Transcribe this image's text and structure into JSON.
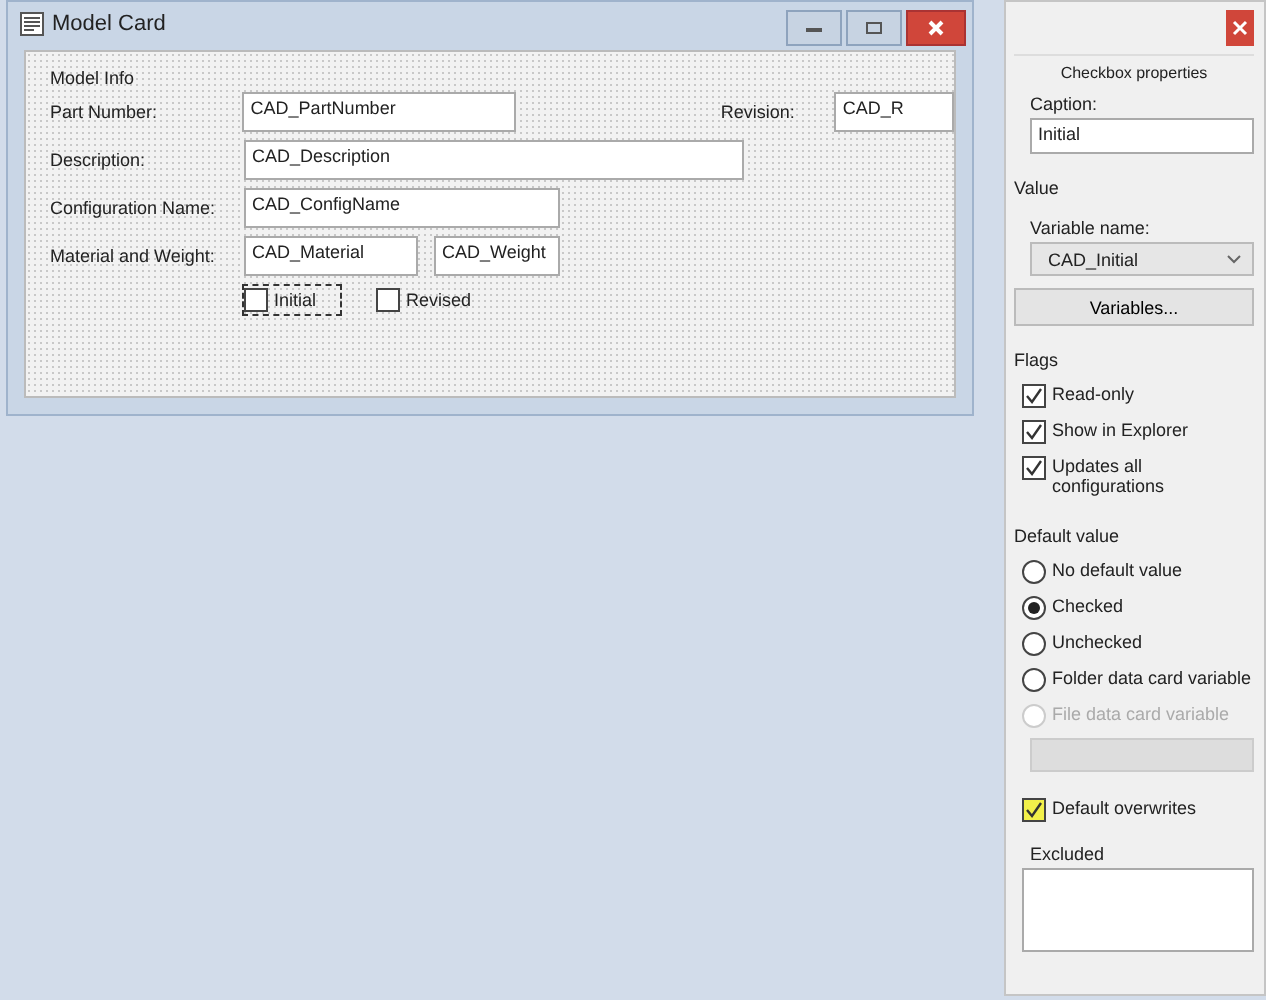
{
  "window": {
    "title": "Model Card"
  },
  "form": {
    "group_label": "Model Info",
    "rows": [
      {
        "label": "Part Number:",
        "fields": [
          "CAD_PartNumber"
        ],
        "extra": {
          "label": "Revision:",
          "value": "CAD_R"
        }
      },
      {
        "label": "Description:",
        "fields": [
          "CAD_Description"
        ]
      },
      {
        "label": "Configuration Name:",
        "fields": [
          "CAD_ConfigName"
        ]
      },
      {
        "label": "Material and Weight:",
        "fields": [
          "CAD_Material",
          "CAD_Weight"
        ]
      }
    ],
    "checkboxes": [
      {
        "label": "Initial",
        "checked": false,
        "selected": true
      },
      {
        "label": "Revised",
        "checked": false,
        "selected": false
      }
    ]
  },
  "panel": {
    "title": "Checkbox properties",
    "caption_label": "Caption:",
    "caption_value": "Initial",
    "value_heading": "Value",
    "variable_label": "Variable name:",
    "variable_value": "CAD_Initial",
    "variables_button": "Variables...",
    "flags_heading": "Flags",
    "flags": [
      {
        "label": "Read-only",
        "checked": true
      },
      {
        "label": "Show in Explorer",
        "checked": true
      },
      {
        "label": "Updates all configurations",
        "checked": true
      }
    ],
    "default_heading": "Default value",
    "defaults": [
      {
        "label": "No default value",
        "selected": false,
        "disabled": false
      },
      {
        "label": "Checked",
        "selected": true,
        "disabled": false
      },
      {
        "label": "Unchecked",
        "selected": false,
        "disabled": false
      },
      {
        "label": "Folder data card variable",
        "selected": false,
        "disabled": false
      },
      {
        "label": "File data card variable",
        "selected": false,
        "disabled": true
      }
    ],
    "overwrite": {
      "label": "Default overwrites",
      "checked": true
    },
    "excluded_label": "Excluded"
  }
}
